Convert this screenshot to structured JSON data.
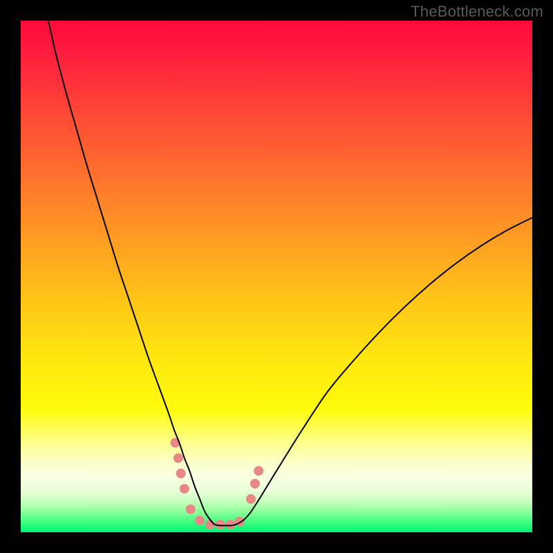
{
  "watermark": "TheBottleneck.com",
  "chart_data": {
    "type": "line",
    "title": "",
    "xlabel": "",
    "ylabel": "",
    "xlim": [
      0,
      100
    ],
    "ylim": [
      0,
      100
    ],
    "grid": false,
    "background_gradient": {
      "stops": [
        {
          "pos": 0.0,
          "color": "#ff0a3a"
        },
        {
          "pos": 0.06,
          "color": "#ff1c3e"
        },
        {
          "pos": 0.18,
          "color": "#ff4736"
        },
        {
          "pos": 0.3,
          "color": "#ff702e"
        },
        {
          "pos": 0.42,
          "color": "#ff9a23"
        },
        {
          "pos": 0.54,
          "color": "#ffc318"
        },
        {
          "pos": 0.66,
          "color": "#ffe70f"
        },
        {
          "pos": 0.76,
          "color": "#fffb0a"
        },
        {
          "pos": 0.82,
          "color": "#fdff84"
        },
        {
          "pos": 0.86,
          "color": "#fdffc4"
        },
        {
          "pos": 0.89,
          "color": "#fbffe2"
        },
        {
          "pos": 0.92,
          "color": "#e8ffd8"
        },
        {
          "pos": 0.94,
          "color": "#c5ffbd"
        },
        {
          "pos": 0.96,
          "color": "#8dff9a"
        },
        {
          "pos": 0.98,
          "color": "#3dff80"
        },
        {
          "pos": 1.0,
          "color": "#00f472"
        }
      ]
    },
    "series": [
      {
        "name": "bottleneck-curve",
        "color": "#000000",
        "stroke_width": 2,
        "x": [
          5.4,
          7,
          9,
          11,
          13,
          15,
          17,
          19,
          21,
          23,
          25,
          27,
          29,
          30,
          31,
          32,
          33,
          34,
          35,
          36,
          37,
          38,
          40,
          42,
          44,
          46,
          50,
          55,
          60,
          65,
          70,
          75,
          80,
          85,
          90,
          95,
          100
        ],
        "y": [
          100,
          93,
          85.5,
          78.5,
          71.5,
          65,
          58.5,
          52,
          46,
          40,
          34,
          28.5,
          23,
          20,
          17.5,
          14.5,
          12,
          9,
          6.5,
          4,
          2.5,
          1.5,
          1.3,
          1.5,
          2.8,
          5.5,
          12,
          20,
          27.5,
          33.5,
          39,
          44,
          48.5,
          52.5,
          56,
          59,
          61.5
        ]
      }
    ],
    "markers": {
      "color": "#e78787",
      "radius": 7,
      "points": [
        {
          "x": 30.2,
          "y": 17.5
        },
        {
          "x": 30.8,
          "y": 14.5
        },
        {
          "x": 31.3,
          "y": 11.5
        },
        {
          "x": 32.0,
          "y": 8.5
        },
        {
          "x": 33.2,
          "y": 4.5
        },
        {
          "x": 35.0,
          "y": 2.3
        },
        {
          "x": 37.0,
          "y": 1.5
        },
        {
          "x": 39.0,
          "y": 1.5
        },
        {
          "x": 41.0,
          "y": 1.5
        },
        {
          "x": 42.8,
          "y": 2.1
        },
        {
          "x": 45.0,
          "y": 6.5
        },
        {
          "x": 45.8,
          "y": 9.5
        },
        {
          "x": 46.5,
          "y": 12.0
        }
      ]
    }
  }
}
